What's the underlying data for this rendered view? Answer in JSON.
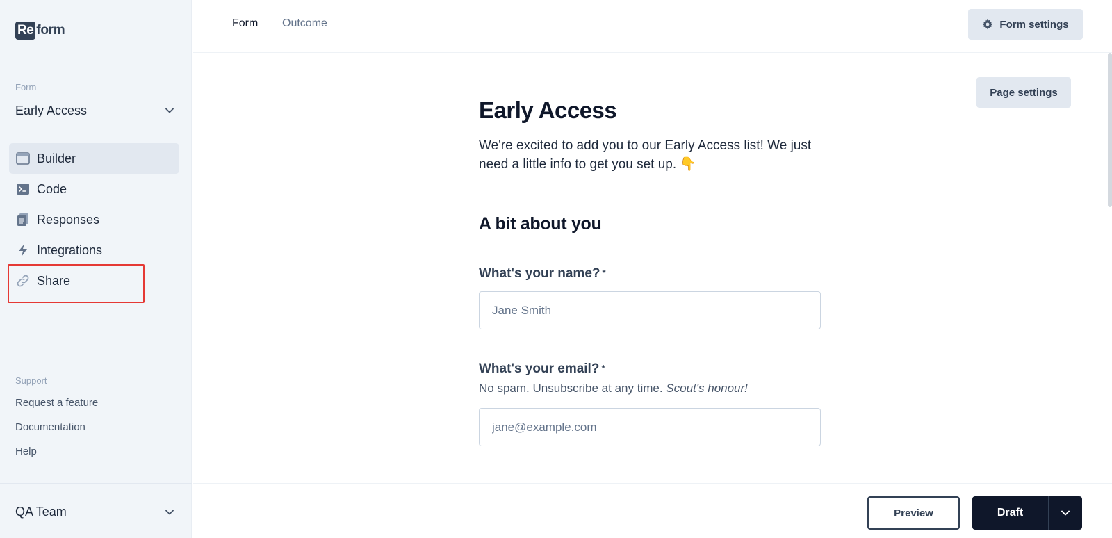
{
  "logo": {
    "part1": "Re",
    "part2": "form"
  },
  "sidebar": {
    "form_section_label": "Form",
    "form_name": "Early Access",
    "nav": [
      {
        "label": "Builder",
        "icon": "window-icon",
        "active": true
      },
      {
        "label": "Code",
        "icon": "terminal-icon",
        "active": false
      },
      {
        "label": "Responses",
        "icon": "clipboard-icon",
        "active": false
      },
      {
        "label": "Integrations",
        "icon": "lightning-icon",
        "active": false
      },
      {
        "label": "Share",
        "icon": "link-icon",
        "active": false
      }
    ],
    "support_label": "Support",
    "support_links": [
      "Request a feature",
      "Documentation",
      "Help"
    ],
    "team_name": "QA Team"
  },
  "topbar": {
    "tabs": [
      {
        "label": "Form",
        "active": true
      },
      {
        "label": "Outcome",
        "active": false
      }
    ],
    "form_settings_label": "Form settings"
  },
  "page": {
    "page_settings_label": "Page settings",
    "title": "Early Access",
    "intro": "We're excited to add you to our Early Access list! We just need a little info to get you set up. 👇",
    "section_heading": "A bit about you",
    "questions": [
      {
        "label": "What's your name?",
        "required_mark": "*",
        "placeholder": "Jane Smith",
        "help": "",
        "help_em": ""
      },
      {
        "label": "What's your email?",
        "required_mark": "*",
        "placeholder": "jane@example.com",
        "help": "No spam. Unsubscribe at any time.",
        "help_em": "Scout's honour!"
      }
    ]
  },
  "actions": {
    "preview_label": "Preview",
    "draft_label": "Draft"
  },
  "colors": {
    "sidebar_bg": "#f1f5f9",
    "primary_dark": "#0f172a",
    "highlight": "#e53935"
  }
}
